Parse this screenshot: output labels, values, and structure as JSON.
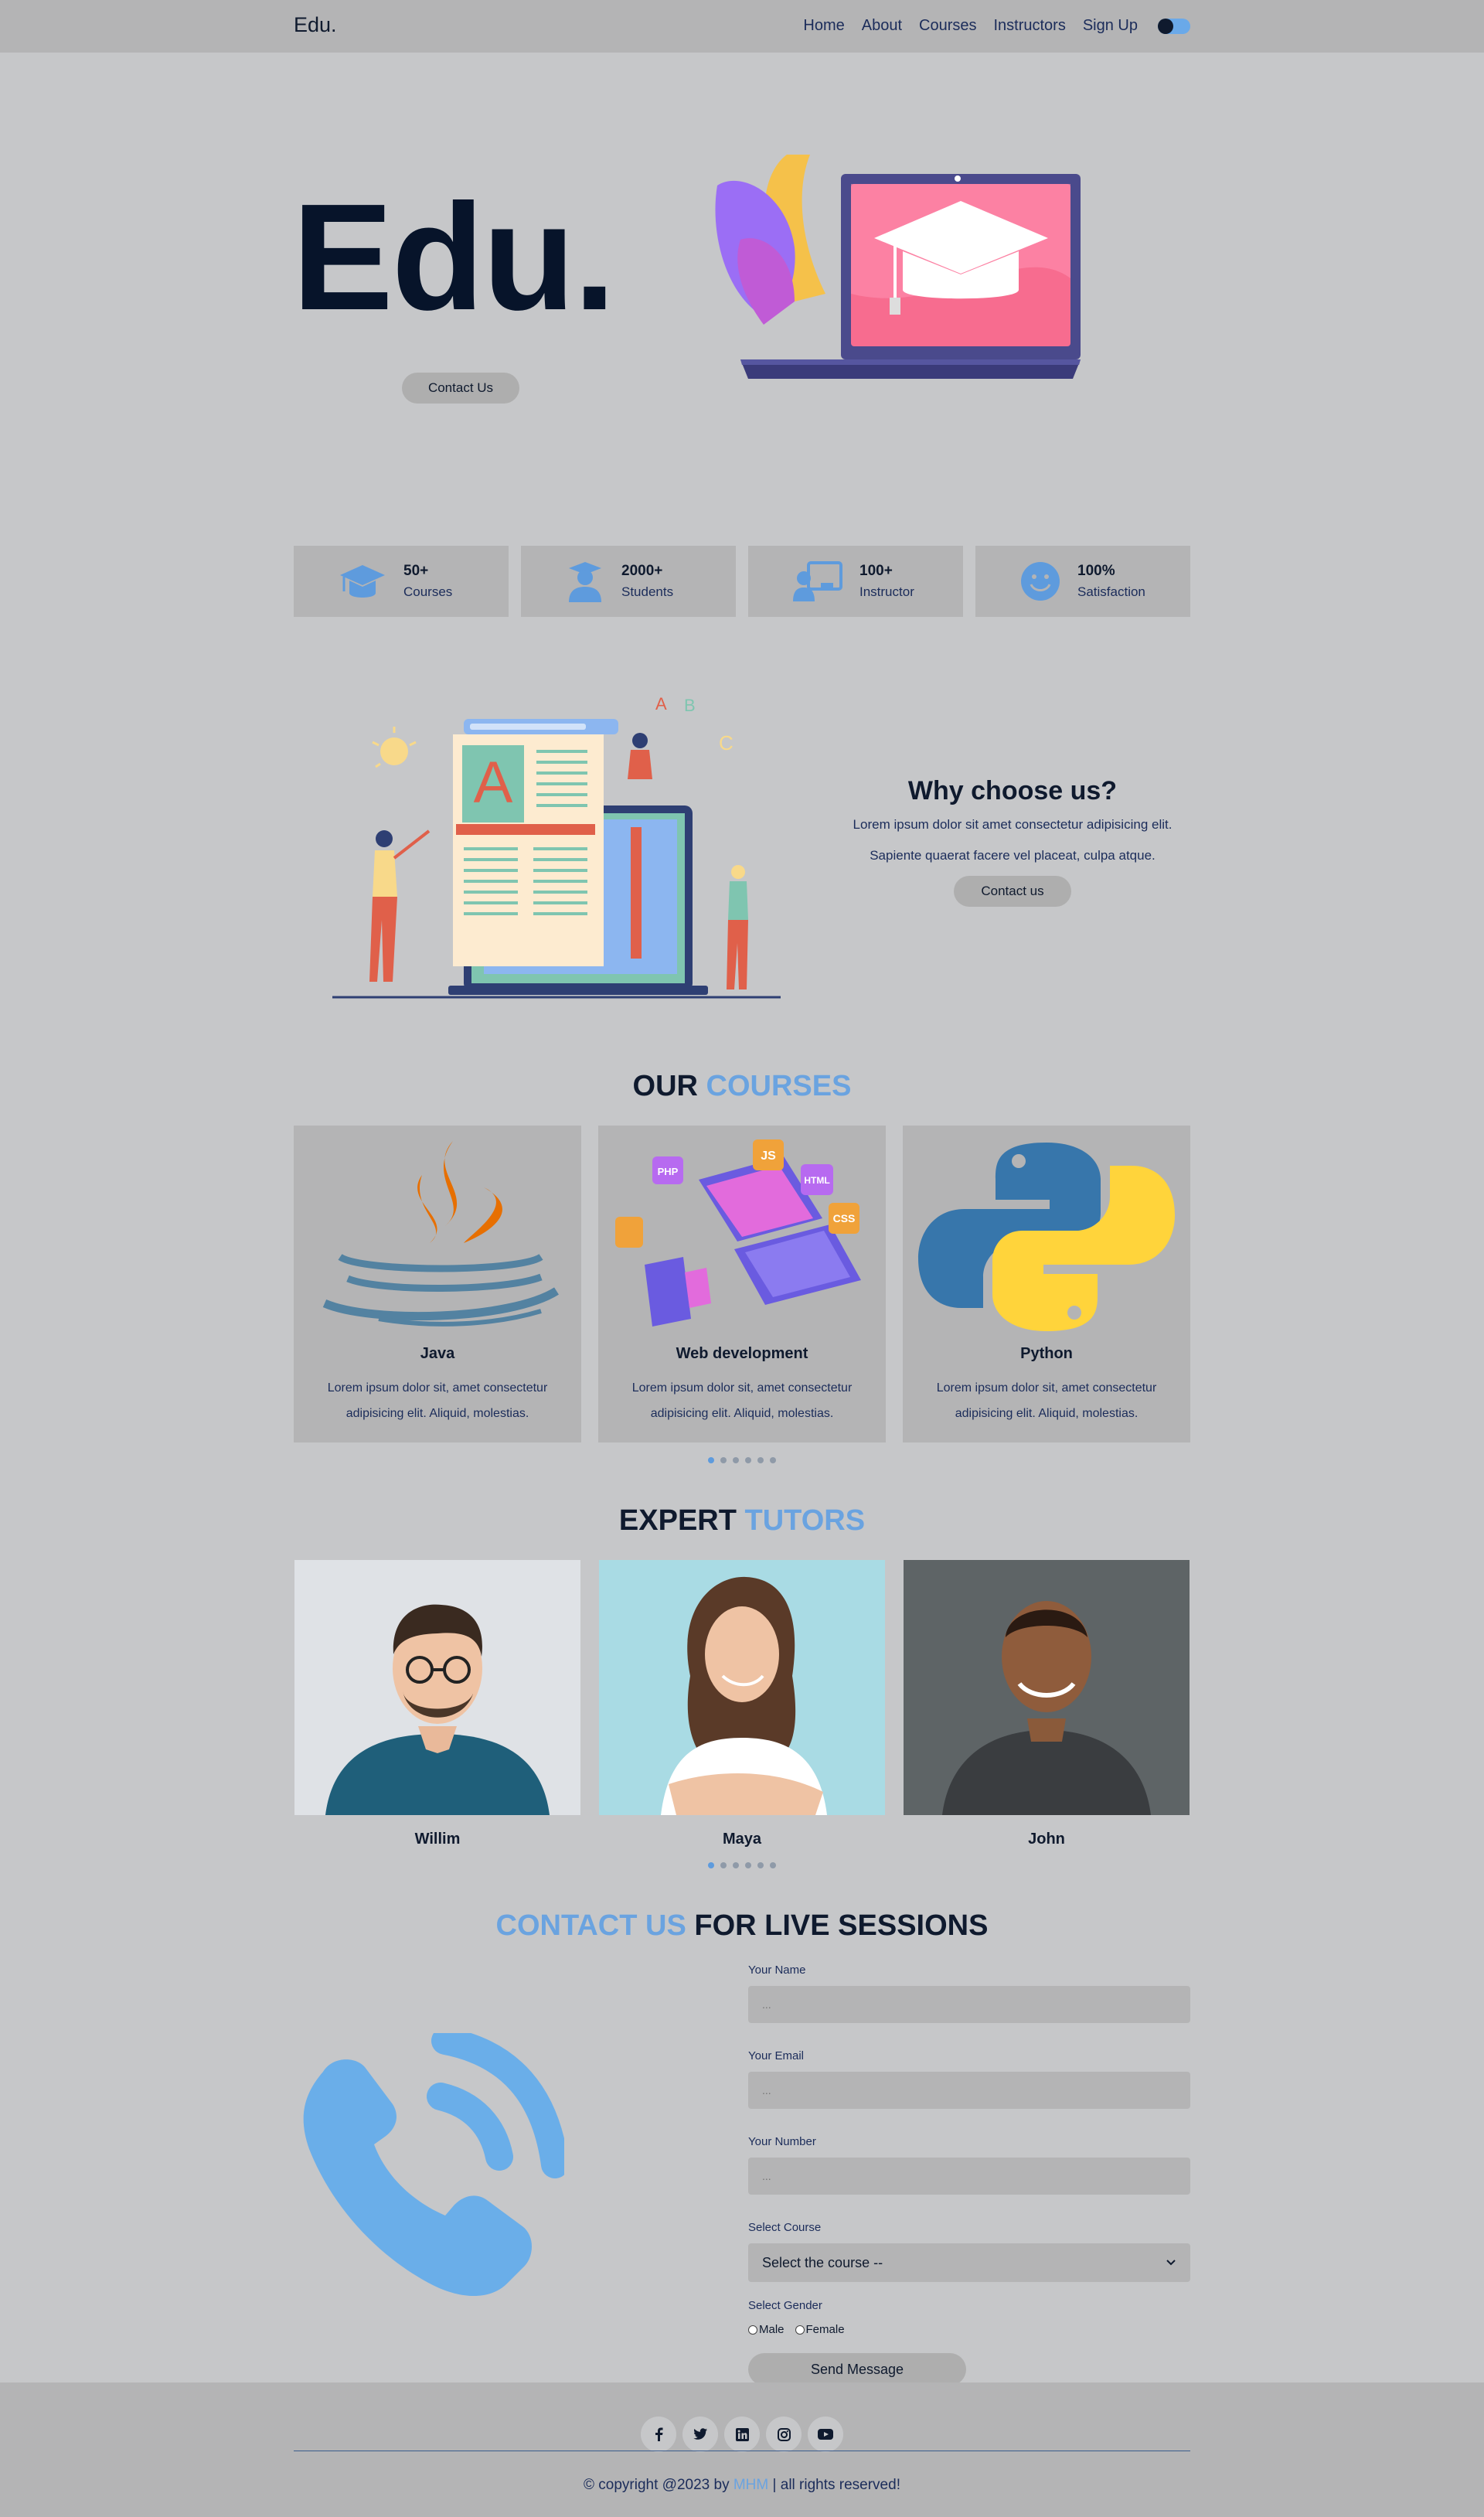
{
  "nav": {
    "brand": "Edu.",
    "links": [
      "Home",
      "About",
      "Courses",
      "Instructors",
      "Sign Up"
    ]
  },
  "hero": {
    "title": "Edu.",
    "contact_label": "Contact Us"
  },
  "stats": [
    {
      "value": "50+",
      "label": "Courses",
      "icon": "graduation-cap-icon"
    },
    {
      "value": "2000+",
      "label": "Students",
      "icon": "student-icon"
    },
    {
      "value": "100+",
      "label": "Instructor",
      "icon": "instructor-icon"
    },
    {
      "value": "100%",
      "label": "Satisfaction",
      "icon": "smile-icon"
    }
  ],
  "why": {
    "title": "Why choose us?",
    "text1": "Lorem ipsum dolor sit amet consectetur adipisicing elit.",
    "text2": "Sapiente quaerat facere vel placeat, culpa atque.",
    "button": "Contact us"
  },
  "courses": {
    "title_part1": "OUR",
    "title_part2": "COURSES",
    "items": [
      {
        "name": "Java",
        "desc": "Lorem ipsum dolor sit, amet consectetur adipisicing elit. Aliquid, molestias."
      },
      {
        "name": "Web development",
        "desc": "Lorem ipsum dolor sit, amet consectetur adipisicing elit. Aliquid, molestias."
      },
      {
        "name": "Python",
        "desc": "Lorem ipsum dolor sit, amet consectetur adipisicing elit. Aliquid, molestias."
      }
    ],
    "web_badges": [
      "PHP",
      "JS",
      "HTML",
      "CSS"
    ]
  },
  "tutors": {
    "title_part1": "EXPERT",
    "title_part2": "TUTORS",
    "items": [
      {
        "name": "Willim"
      },
      {
        "name": "Maya"
      },
      {
        "name": "John"
      }
    ]
  },
  "contact": {
    "title_part1": "CONTACT US",
    "title_part2": "FOR LIVE SESSIONS",
    "name_label": "Your Name",
    "name_placeholder": "...",
    "email_label": "Your Email",
    "email_placeholder": "...",
    "number_label": "Your Number",
    "number_placeholder": "...",
    "course_label": "Select Course",
    "course_value": "Select the course --",
    "gender_label": "Select Gender",
    "gender_male": "Male",
    "gender_female": "Female",
    "send_label": "Send Message"
  },
  "footer": {
    "socials": [
      "facebook-icon",
      "twitter-icon",
      "linkedin-icon",
      "instagram-icon",
      "youtube-icon"
    ],
    "copyright_pre": "© copyright @2023 by",
    "copyright_name": "MHM",
    "copyright_post": "| all rights reserved!"
  },
  "colors": {
    "background": "#c6c7c9",
    "surface": "#b4b4b5",
    "accent": "#6aa3e0",
    "text": "#0f1a2e"
  }
}
